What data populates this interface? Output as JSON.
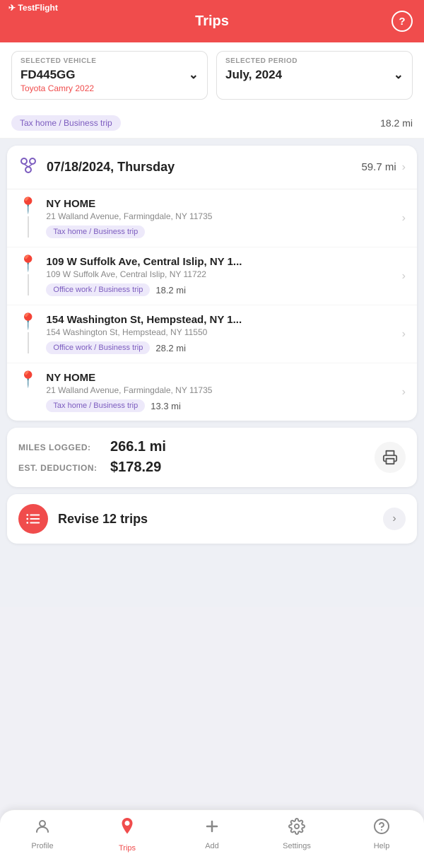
{
  "header": {
    "testflight_label": "✈ TestFlight",
    "title": "Trips",
    "help_icon": "?"
  },
  "filters": {
    "vehicle": {
      "label": "SELECTED VEHICLE",
      "value": "FD445GG",
      "sub": "Toyota Camry 2022"
    },
    "period": {
      "label": "SELECTED PERIOD",
      "value": "July, 2024"
    }
  },
  "partial_row": {
    "badge": "Tax home / Business trip",
    "miles": "18.2 mi"
  },
  "day": {
    "date": "07/18/2024, Thursday",
    "total_miles": "59.7 mi",
    "trips": [
      {
        "name": "NY HOME",
        "address": "21 Walland Avenue, Farmingdale, NY 11735",
        "badge": "Tax home / Business trip",
        "miles": ""
      },
      {
        "name": "109 W Suffolk Ave, Central Islip, NY 1...",
        "address": "109 W Suffolk Ave, Central Islip, NY 11722",
        "badge": "Office work / Business trip",
        "miles": "18.2 mi"
      },
      {
        "name": "154 Washington St, Hempstead, NY 1...",
        "address": "154 Washington St, Hempstead, NY 11550",
        "badge": "Office work / Business trip",
        "miles": "28.2 mi"
      },
      {
        "name": "NY HOME",
        "address": "21 Walland Avenue, Farmingdale, NY 11735",
        "badge": "Tax home / Business trip",
        "miles": "13.3 mi"
      }
    ]
  },
  "summary": {
    "miles_label": "MILES LOGGED:",
    "miles_value": "266.1 mi",
    "deduction_label": "EST. DEDUCTION:",
    "deduction_value": "$178.29"
  },
  "revise": {
    "label": "Revise 12 trips"
  },
  "bottom_nav": {
    "items": [
      {
        "id": "profile",
        "label": "Profile",
        "icon": "person"
      },
      {
        "id": "trips",
        "label": "Trips",
        "icon": "pin",
        "active": true
      },
      {
        "id": "add",
        "label": "Add",
        "icon": "plus"
      },
      {
        "id": "settings",
        "label": "Settings",
        "icon": "gear"
      },
      {
        "id": "help",
        "label": "Help",
        "icon": "help"
      }
    ]
  }
}
